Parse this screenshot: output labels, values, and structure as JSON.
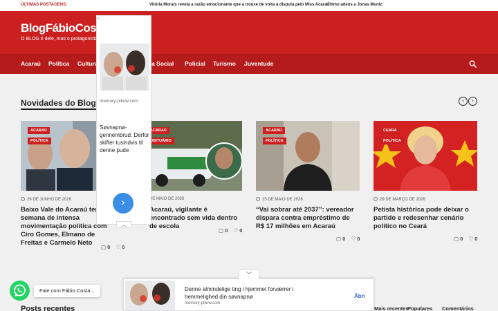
{
  "ticker": {
    "label": "ÚLTIMAS POSTAGENS:",
    "items": [
      "Vitória Morais revela a razão emocionante que a trouxe de volta à disputa pelo Miss Acaraú",
      "Último adeus a Jonas Muniz:"
    ]
  },
  "header": {
    "logo": "BlogFábioCosta",
    "tagline": "O BLOG é dele, mas o protagonista é você"
  },
  "nav": {
    "items": [
      "Acaraú",
      "Política",
      "Cultura",
      "Coluna Social",
      "Policial",
      "Turismo",
      "Juventude"
    ]
  },
  "section": {
    "title": "Novidades do Blog",
    "prev_icon": "chevron-left-circle-icon",
    "next_icon": "chevron-right-circle-icon"
  },
  "cards": [
    {
      "badges": [
        "ACARAÚ",
        "POLÍTICA"
      ],
      "date": "26 DE JUNHO DE 2026",
      "title": "Baixo Vale do Acaraú terá semana de intensa movimentação política com Ciro Gomes, Elmano de Freitas e Carmelo Neto",
      "comments": "0",
      "likes": "0"
    },
    {
      "badges": [
        "ACARAÚ",
        "OBITUÁRIO"
      ],
      "date": "DE MAIO DE 2026",
      "title": "Acaraú, vigilante é encontrado sem vida dentro de escola",
      "comments": "0",
      "likes": "0"
    },
    {
      "badges": [
        "ACARAÚ",
        "POLÍTICA"
      ],
      "date": "15 DE MAIO DE 2026",
      "title": "“Vai sobrar até 2037”: vereador dispara contra empréstimo de R$ 17 milhões em Acaraú",
      "comments": "0",
      "likes": "0"
    },
    {
      "badges": [
        "CEARÁ",
        "POLÍTICA"
      ],
      "date": "29 DE MARÇO DE 2026",
      "title": "Petista histórica pode deixar o partido e redesenhar cenário político no Ceará",
      "comments": "0",
      "likes": "0"
    }
  ],
  "ad_vertical": {
    "domain": "memory-pillow.com",
    "text": "Søvnapnø-gennembrud: Derfor skifter tusindvis til denne pude"
  },
  "ad_bottom": {
    "text": "Denne almindelige ting i hjemmet forværrer i hemmelighed din søvnapnø",
    "domain": "memory-pillow.com",
    "cta": "Åbn"
  },
  "whatsapp": {
    "label": "Fale com Fábio Costa..."
  },
  "footer": {
    "posts_title": "Posts recentes",
    "tabs": [
      "Mais recentes",
      "Populares",
      "Comentários"
    ]
  },
  "colors": {
    "brand": "#cc1f1f",
    "nav": "#b51b1b",
    "ad_accent": "#3a8ee6",
    "whatsapp": "#25d366"
  }
}
